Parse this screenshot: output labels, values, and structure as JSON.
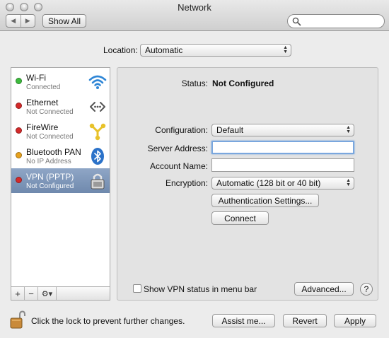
{
  "window": {
    "title": "Network"
  },
  "toolbar": {
    "back_glyph": "◀",
    "forward_glyph": "▶",
    "show_all_label": "Show All",
    "search_placeholder": ""
  },
  "location": {
    "label": "Location:",
    "value": "Automatic"
  },
  "services": [
    {
      "name": "Wi-Fi",
      "status": "Connected",
      "dot_color": "#3dbb3d",
      "icon": "wifi-icon",
      "selected": false
    },
    {
      "name": "Ethernet",
      "status": "Not Connected",
      "dot_color": "#d42a2a",
      "icon": "ethernet-icon",
      "selected": false
    },
    {
      "name": "FireWire",
      "status": "Not Connected",
      "dot_color": "#d42a2a",
      "icon": "firewire-icon",
      "selected": false
    },
    {
      "name": "Bluetooth PAN",
      "status": "No IP Address",
      "dot_color": "#e8a21e",
      "icon": "bluetooth-icon",
      "selected": false
    },
    {
      "name": "VPN (PPTP)",
      "status": "Not Configured",
      "dot_color": "#d42a2a",
      "icon": "vpn-lock-icon",
      "selected": true
    }
  ],
  "sidebar_footer": {
    "add": "+",
    "remove": "−",
    "gear": "⚙▾"
  },
  "detail": {
    "status_label": "Status:",
    "status_value": "Not Configured",
    "configuration_label": "Configuration:",
    "configuration_value": "Default",
    "server_address_label": "Server Address:",
    "server_address_value": "",
    "account_name_label": "Account Name:",
    "account_name_value": "",
    "encryption_label": "Encryption:",
    "encryption_value": "Automatic (128 bit or 40 bit)",
    "auth_settings_button": "Authentication Settings...",
    "connect_button": "Connect",
    "show_vpn_status_label": "Show VPN status in menu bar",
    "show_vpn_status_checked": false,
    "advanced_button": "Advanced...",
    "help_glyph": "?"
  },
  "bottom": {
    "lock_text": "Click the lock to prevent further changes.",
    "assist_button": "Assist me...",
    "revert_button": "Revert",
    "apply_button": "Apply"
  },
  "colors": {
    "selection": "#7d96bb",
    "focus_ring": "#7aa7de"
  }
}
